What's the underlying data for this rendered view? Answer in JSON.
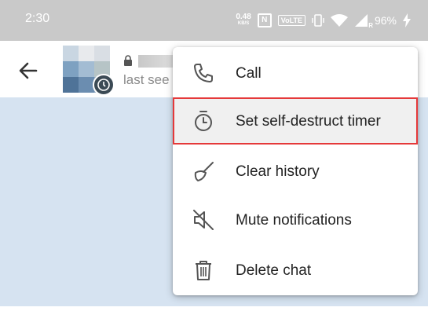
{
  "status_bar": {
    "time": "2:30",
    "net_speed_value": "0.48",
    "net_speed_unit": "KB/S",
    "nfc_label": "N",
    "volte_label": "VoLTE",
    "network_type": "R",
    "battery_percent": "96%"
  },
  "app_bar": {
    "contact_status": "last see"
  },
  "menu": {
    "items": [
      {
        "label": "Call",
        "icon": "phone-icon"
      },
      {
        "label": "Set self-destruct timer",
        "icon": "timer-icon",
        "selected": true
      },
      {
        "label": "Clear history",
        "icon": "broom-icon"
      },
      {
        "label": "Mute notifications",
        "icon": "mute-icon"
      },
      {
        "label": "Delete chat",
        "icon": "trash-icon"
      }
    ]
  },
  "colors": {
    "status_bar": "#c9c9c9",
    "chat_background": "#d6e3f1",
    "highlight_outline": "#e5393a"
  }
}
